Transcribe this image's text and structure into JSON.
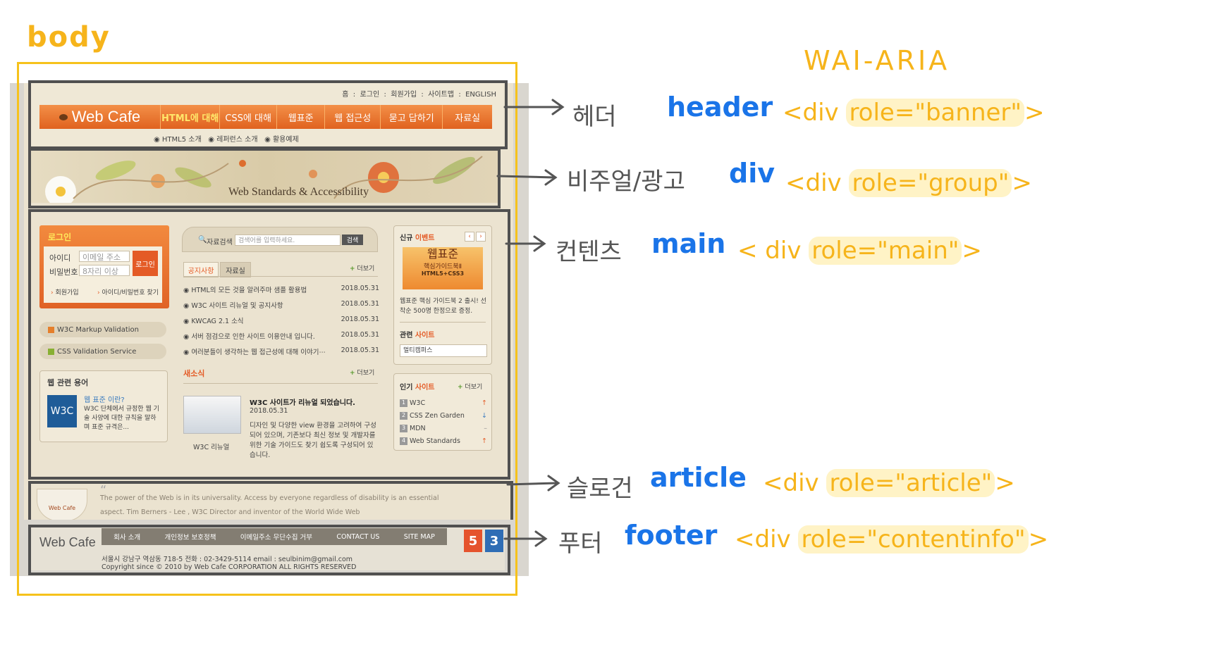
{
  "body_label": "body",
  "wai_aria_title": "WAI-ARIA",
  "annotations": [
    {
      "korean": "헤더",
      "tag": "header",
      "code_prefix": "<div ",
      "role_attr": "role=\"banner\"",
      "code_suffix": ">"
    },
    {
      "korean": "비주얼/광고",
      "tag": "div",
      "code_prefix": "<div ",
      "role_attr": "role=\"group\"",
      "code_suffix": ">"
    },
    {
      "korean": "컨텐츠",
      "tag": "main",
      "code_prefix": "< div ",
      "role_attr": "role=\"main\"",
      "code_suffix": ">"
    },
    {
      "korean": "슬로건",
      "tag": "article",
      "code_prefix": "<div ",
      "role_attr": "role=\"article\"",
      "code_suffix": ">"
    },
    {
      "korean": "푸터",
      "tag": "footer",
      "code_prefix": "<div ",
      "role_attr": "role=\"contentinfo\"",
      "code_suffix": ">"
    }
  ],
  "site": {
    "util_links": [
      "홈",
      "로그인",
      "회원가입",
      "사이트맵",
      "ENGLISH"
    ],
    "logo": "Web Cafe",
    "menu": [
      "HTML에 대해",
      "CSS에 대해",
      "웹표준",
      "웹 접근성",
      "묻고 답하기",
      "자료실"
    ],
    "submenu": [
      "HTML5 소개",
      "레퍼런스 소개",
      "활용예제"
    ],
    "visual_text": "Web Standards & Accessibility",
    "login": {
      "title": "로그인",
      "id_label": "아이디",
      "id_placeholder": "이메일 주소",
      "pw_label": "비밀번호",
      "pw_placeholder": "8자리 이상",
      "button": "로그인",
      "join": "회원가입",
      "find": "아이디/비밀번호 찾기"
    },
    "validators": [
      "W3C Markup Validation",
      "CSS Validation Service"
    ],
    "glossary": {
      "title": "웹 관련 용어",
      "logo": "W3C",
      "heading": "웹 표준 이란?",
      "text": "W3C 단체에서 규정한 웹 기술 사양에 대한 규칙을 말하며 표준 규격은..."
    },
    "search": {
      "label": "자료검색",
      "placeholder": "검색어를 입력하세요.",
      "button": "검색"
    },
    "tabs": [
      "공지사항",
      "자료실"
    ],
    "more": "더보기",
    "notices": [
      {
        "title": "HTML의 모든 것을 알려주마 샘플 활용법",
        "date": "2018.05.31"
      },
      {
        "title": "W3C 사이트 리뉴얼 및 공지사항",
        "date": "2018.05.31"
      },
      {
        "title": "KWCAG 2.1 소식",
        "date": "2018.05.31"
      },
      {
        "title": "서버 점검으로 인한 사이트 이용안내 입니다.",
        "date": "2018.05.31"
      },
      {
        "title": "여러분들이 생각하는 웹 접근성에 대해 이야기⋯",
        "date": "2018.05.31"
      }
    ],
    "news": {
      "title": "새소식",
      "thumb_caption": "W3C 리뉴얼",
      "headline": "W3C 사이트가 리뉴얼 되었습니다.",
      "date": "2018.05.31",
      "body": "디자인 및 다양한 view 환경을 고려하여 구성되어 있으며, 기존보다 최신 정보 및 개발자를 위한 기술 가이드도 찾기 쉽도록 구성되어 있습니다."
    },
    "event": {
      "title_a": "신규",
      "title_b": "이벤트",
      "book_title": "웹표준",
      "book_sub": "핵심가이드북Ⅱ",
      "book_tag": "HTML5+CSS3",
      "desc": "웹표준 핵심 가이드북 2 출시! 선착순 500명 한정으로 증정."
    },
    "related": {
      "title_a": "관련",
      "title_b": "사이트",
      "select": "멀티캠퍼스"
    },
    "popular": {
      "title_a": "인기",
      "title_b": "사이트",
      "items": [
        {
          "rank": "1",
          "name": "W3C",
          "trend": "up"
        },
        {
          "rank": "2",
          "name": "CSS Zen Garden",
          "trend": "down"
        },
        {
          "rank": "3",
          "name": "MDN",
          "trend": "same"
        },
        {
          "rank": "4",
          "name": "Web Standards",
          "trend": "up"
        }
      ]
    },
    "slogan": "The power of the Web is in its universality. Access by everyone regardless of disability is an essential aspect. Tim Berners - Lee , W3C Director and inventor of the World Wide Web",
    "cup_label": "Web Cafe",
    "footer": {
      "logo": "Web Cafe",
      "links": [
        "회사 소개",
        "개인정보 보호정책",
        "이메일주소 무단수집 거부",
        "CONTACT US",
        "SITE MAP"
      ],
      "address": "서울시 강남구 역삼동 718-5 전화 : 02-3429-5114 email : seulbinim@gmail.com",
      "copyright": "Copyright since © 2010 by Web Cafe CORPORATION ALL RIGHTS RESERVED",
      "badges": [
        "5",
        "3"
      ]
    }
  },
  "colors": {
    "annotation_yellow": "#f6b41b",
    "annotation_blue": "#1a74e8",
    "outline_gray": "#505050",
    "menu_orange": "#e8662a",
    "site_beige": "#ebe3d0"
  }
}
